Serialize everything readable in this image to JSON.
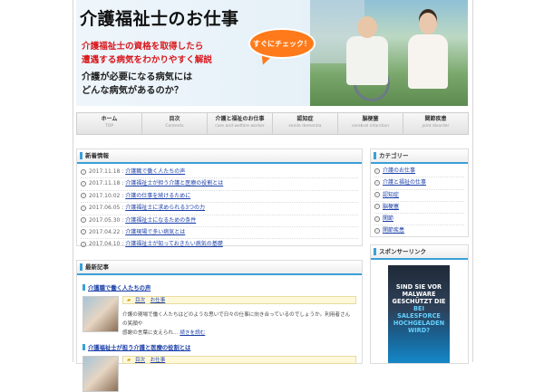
{
  "header": {
    "title": "介護福祉士のお仕事",
    "lead_red": [
      "介護福祉士の資格を取得したら",
      "遭遇する病気をわかりやすく解説"
    ],
    "lead_black": [
      "介護が必要になる病気には",
      "どんな病気があるのか？"
    ],
    "bubble": "すぐにチェック！"
  },
  "nav": [
    {
      "label": "ホーム",
      "sub": "TOP"
    },
    {
      "label": "目次",
      "sub": "Contents"
    },
    {
      "label": "介護と福祉のお仕事",
      "sub": "care and welfare worker"
    },
    {
      "label": "認知症",
      "sub": "senile dementia"
    },
    {
      "label": "脳梗塞",
      "sub": "cerebral infarction"
    },
    {
      "label": "関節疾患",
      "sub": "joint disorder"
    }
  ],
  "news": {
    "title": "新着情報",
    "items": [
      {
        "date": "2017.11.18 :",
        "text": "介護職で働く人たちの声"
      },
      {
        "date": "2017.11.18 :",
        "text": "介護福祉士が担う介護と医療の役割とは"
      },
      {
        "date": "2017.10.02 :",
        "text": "介護の仕事を続けるために"
      },
      {
        "date": "2017.06.05 :",
        "text": "介護福祉士に求められる3つの力"
      },
      {
        "date": "2017.05.30 :",
        "text": "介護福祉士になるための条件"
      },
      {
        "date": "2017.04.22 :",
        "text": "介護現場で多い病気とは"
      },
      {
        "date": "2017.04.10 :",
        "text": "介護福祉士が知っておきたい病気の基礎"
      }
    ]
  },
  "latest": {
    "title": "最新記事",
    "posts": [
      {
        "title": "介護職で働く人たちの声",
        "tags": [
          "目次",
          "お仕事"
        ],
        "excerpt_lines": [
          "介護の現場で働く人たちはどのような思いで日々の仕事に向き合っているのでしょうか。利用者さんの笑顔や",
          "感謝の言葉に支えられ…",
          "続きを読む"
        ]
      },
      {
        "title": "介護福祉士が担う介護と医療の役割とは",
        "tags": [
          "目次",
          "お仕事"
        ],
        "excerpt_lines": []
      }
    ]
  },
  "categories": {
    "title": "カテゴリー",
    "items": [
      "介護のお仕事",
      "介護と福祉の仕事",
      "認知症",
      "脳梗塞",
      "関節",
      "関節疾患"
    ]
  },
  "sponsor": {
    "title": "スポンサーリンク",
    "ad_lines": [
      "SIND SIE VOR",
      "MALWARE",
      "GESCHÜTZT DIE",
      "BEI",
      "SALESFORCE",
      "HOCHGELADEN",
      "WIRD?"
    ]
  },
  "colors": {
    "accent": "#3aa0d8",
    "link": "#1a3ea8",
    "lead_red": "#d8161b",
    "bubble": "#ff7a1a"
  }
}
